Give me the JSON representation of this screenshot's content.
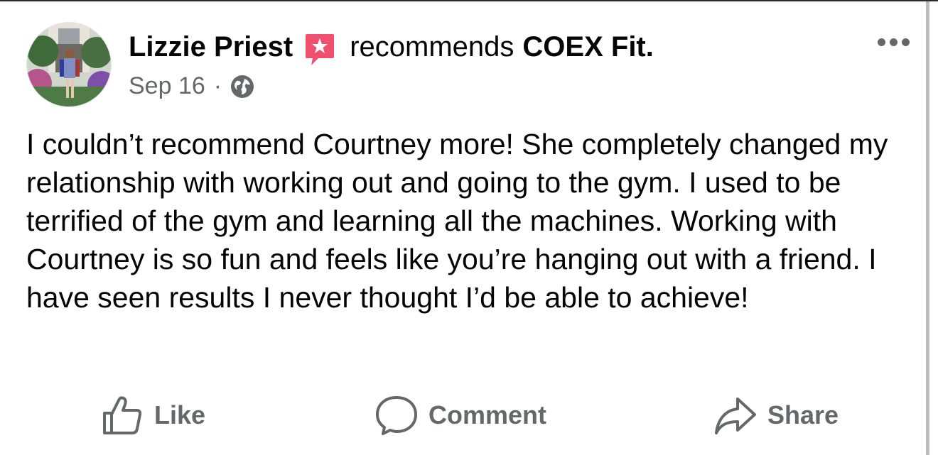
{
  "post": {
    "author": "Lizzie Priest",
    "action_text": "recommends",
    "page_name": "COEX Fit.",
    "date": "Sep 16",
    "separator": "·",
    "privacy_icon": "globe-icon",
    "body": "I couldn’t recommend Courtney more! She completely changed my relationship with working out and going to the gym. I used to be terrified of the gym and learning all the machines. Working with Courtney is so fun and feels like you’re hanging out with a friend. I have seen results I never thought I’d be able to achieve!"
  },
  "actions": {
    "like_label": "Like",
    "comment_label": "Comment",
    "share_label": "Share"
  },
  "colors": {
    "text_primary": "#050505",
    "text_secondary": "#65676b",
    "recommend_badge": "#f0506e"
  }
}
